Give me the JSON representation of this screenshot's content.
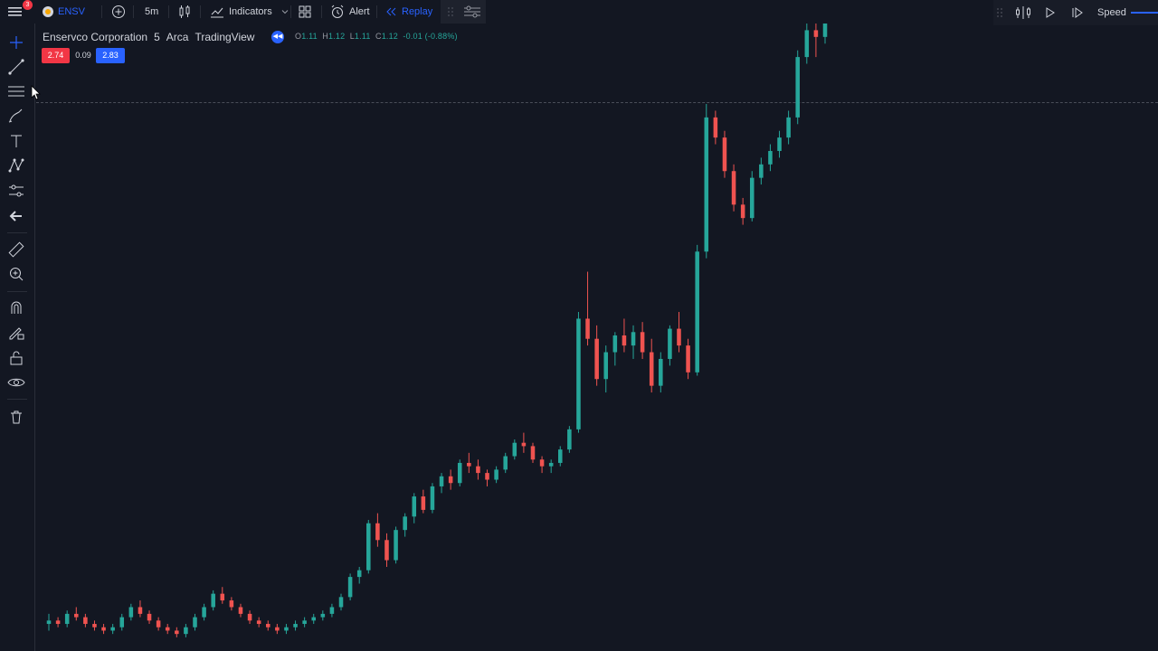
{
  "toolbar": {
    "notification_count": "3",
    "symbol": "ENSV",
    "interval": "5m",
    "indicators_label": "Indicators",
    "alert_label": "Alert",
    "replay_label": "Replay",
    "speed_label": "Speed"
  },
  "legend": {
    "name": "Enservco Corporation",
    "interval": "5",
    "exchange": "Arca",
    "source": "TradingView",
    "ohlc": [
      {
        "k": "O",
        "v": "1.11"
      },
      {
        "k": "H",
        "v": "1.12"
      },
      {
        "k": "L",
        "v": "1.11"
      },
      {
        "k": "C",
        "v": "1.12"
      }
    ],
    "change": "-0.01 (-0.88%)"
  },
  "prices": {
    "bid": "2.74",
    "spread": "0.09",
    "ask": "2.83"
  },
  "colors": {
    "up": "#26a69a",
    "down": "#ef5350",
    "accent": "#2962ff",
    "background": "#131722"
  },
  "icons": {
    "left_toolbar": [
      "crosshair-icon",
      "trend-line-icon",
      "fib-icon",
      "brush-icon",
      "text-icon",
      "pattern-icon",
      "forecast-icon",
      "back-arrow-icon",
      "ruler-icon",
      "zoom-in-icon",
      "magnet-icon",
      "pencil-lock-icon",
      "lock-icon",
      "eye-icon",
      "trash-icon"
    ]
  },
  "chart_data": {
    "type": "candlestick",
    "note_series": "5m candles, rendered left to right",
    "candles": [
      [
        0.27,
        0.3,
        0.25,
        0.28
      ],
      [
        0.28,
        0.29,
        0.26,
        0.27
      ],
      [
        0.27,
        0.31,
        0.26,
        0.3
      ],
      [
        0.3,
        0.32,
        0.28,
        0.29
      ],
      [
        0.29,
        0.3,
        0.26,
        0.27
      ],
      [
        0.27,
        0.28,
        0.25,
        0.26
      ],
      [
        0.26,
        0.27,
        0.24,
        0.25
      ],
      [
        0.25,
        0.27,
        0.24,
        0.26
      ],
      [
        0.26,
        0.3,
        0.25,
        0.29
      ],
      [
        0.29,
        0.33,
        0.28,
        0.32
      ],
      [
        0.32,
        0.34,
        0.29,
        0.3
      ],
      [
        0.3,
        0.31,
        0.27,
        0.28
      ],
      [
        0.28,
        0.29,
        0.25,
        0.26
      ],
      [
        0.26,
        0.27,
        0.24,
        0.25
      ],
      [
        0.25,
        0.26,
        0.23,
        0.24
      ],
      [
        0.24,
        0.27,
        0.23,
        0.26
      ],
      [
        0.26,
        0.3,
        0.25,
        0.29
      ],
      [
        0.29,
        0.33,
        0.28,
        0.32
      ],
      [
        0.32,
        0.37,
        0.31,
        0.36
      ],
      [
        0.36,
        0.38,
        0.33,
        0.34
      ],
      [
        0.34,
        0.35,
        0.31,
        0.32
      ],
      [
        0.32,
        0.33,
        0.29,
        0.3
      ],
      [
        0.3,
        0.31,
        0.27,
        0.28
      ],
      [
        0.28,
        0.29,
        0.26,
        0.27
      ],
      [
        0.27,
        0.28,
        0.25,
        0.26
      ],
      [
        0.26,
        0.27,
        0.24,
        0.25
      ],
      [
        0.25,
        0.27,
        0.24,
        0.26
      ],
      [
        0.26,
        0.28,
        0.25,
        0.27
      ],
      [
        0.27,
        0.29,
        0.26,
        0.28
      ],
      [
        0.28,
        0.3,
        0.27,
        0.29
      ],
      [
        0.29,
        0.31,
        0.28,
        0.3
      ],
      [
        0.3,
        0.33,
        0.29,
        0.32
      ],
      [
        0.32,
        0.36,
        0.31,
        0.35
      ],
      [
        0.35,
        0.42,
        0.34,
        0.41
      ],
      [
        0.41,
        0.44,
        0.39,
        0.43
      ],
      [
        0.43,
        0.58,
        0.42,
        0.57
      ],
      [
        0.57,
        0.6,
        0.5,
        0.52
      ],
      [
        0.52,
        0.54,
        0.44,
        0.46
      ],
      [
        0.46,
        0.56,
        0.45,
        0.55
      ],
      [
        0.55,
        0.6,
        0.53,
        0.59
      ],
      [
        0.59,
        0.66,
        0.57,
        0.65
      ],
      [
        0.65,
        0.67,
        0.6,
        0.61
      ],
      [
        0.61,
        0.69,
        0.6,
        0.68
      ],
      [
        0.68,
        0.72,
        0.66,
        0.71
      ],
      [
        0.71,
        0.73,
        0.67,
        0.69
      ],
      [
        0.69,
        0.76,
        0.68,
        0.75
      ],
      [
        0.75,
        0.78,
        0.72,
        0.74
      ],
      [
        0.74,
        0.76,
        0.7,
        0.72
      ],
      [
        0.72,
        0.73,
        0.68,
        0.7
      ],
      [
        0.7,
        0.74,
        0.69,
        0.73
      ],
      [
        0.73,
        0.78,
        0.72,
        0.77
      ],
      [
        0.77,
        0.82,
        0.76,
        0.81
      ],
      [
        0.81,
        0.84,
        0.78,
        0.8
      ],
      [
        0.8,
        0.81,
        0.75,
        0.76
      ],
      [
        0.76,
        0.77,
        0.72,
        0.74
      ],
      [
        0.74,
        0.76,
        0.72,
        0.75
      ],
      [
        0.75,
        0.8,
        0.74,
        0.79
      ],
      [
        0.79,
        0.86,
        0.78,
        0.85
      ],
      [
        0.85,
        1.2,
        0.84,
        1.18
      ],
      [
        1.18,
        1.32,
        1.1,
        1.12
      ],
      [
        1.12,
        1.16,
        0.98,
        1.0
      ],
      [
        1.0,
        1.1,
        0.96,
        1.08
      ],
      [
        1.08,
        1.14,
        1.04,
        1.13
      ],
      [
        1.13,
        1.18,
        1.08,
        1.1
      ],
      [
        1.1,
        1.16,
        1.06,
        1.14
      ],
      [
        1.14,
        1.17,
        1.06,
        1.08
      ],
      [
        1.08,
        1.12,
        0.96,
        0.98
      ],
      [
        0.98,
        1.08,
        0.96,
        1.06
      ],
      [
        1.06,
        1.16,
        1.04,
        1.15
      ],
      [
        1.15,
        1.2,
        1.08,
        1.1
      ],
      [
        1.1,
        1.12,
        1.0,
        1.02
      ],
      [
        1.02,
        1.4,
        1.01,
        1.38
      ],
      [
        1.38,
        1.82,
        1.36,
        1.78
      ],
      [
        1.78,
        1.8,
        1.7,
        1.72
      ],
      [
        1.72,
        1.74,
        1.6,
        1.62
      ],
      [
        1.62,
        1.64,
        1.5,
        1.52
      ],
      [
        1.52,
        1.54,
        1.46,
        1.48
      ],
      [
        1.48,
        1.62,
        1.47,
        1.6
      ],
      [
        1.6,
        1.66,
        1.58,
        1.64
      ],
      [
        1.64,
        1.7,
        1.62,
        1.68
      ],
      [
        1.68,
        1.74,
        1.66,
        1.72
      ],
      [
        1.72,
        1.8,
        1.7,
        1.78
      ],
      [
        1.78,
        1.98,
        1.76,
        1.96
      ],
      [
        1.96,
        2.06,
        1.94,
        2.04
      ],
      [
        2.04,
        2.06,
        1.96,
        2.02
      ],
      [
        2.02,
        2.08,
        2.0,
        2.06
      ]
    ],
    "ylim": [
      0.2,
      2.06
    ],
    "dashed_price_level": 1.9
  }
}
